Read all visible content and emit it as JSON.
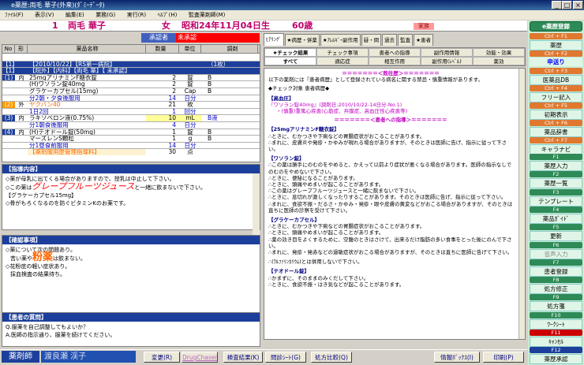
{
  "window": {
    "title": "e薬歴:両毛  華子(外来)(ﾀﾞﾐｰﾃﾞｰﾀ)",
    "controls": [
      "_",
      "□",
      "×"
    ]
  },
  "menu": [
    "ﾌｧｲﾙ(F)",
    "表示(V)",
    "編集(E)",
    "業務(G)",
    "実行(R)",
    "ﾍﾙﾌﾟ(H)",
    "監査薬剤師(M)"
  ],
  "patient": {
    "id": "1",
    "name": "両毛  華子",
    "sex": "女",
    "birth": "昭和24年11月04日生",
    "age": "60歳",
    "family": "家族"
  },
  "approver": {
    "label": "承認者",
    "value": "未承認"
  },
  "rx": {
    "headers": [
      "No",
      "形",
      "薬品名称",
      "数量",
      "単位",
      "調剤"
    ],
    "rows": [
      {
        "no": "",
        "form": "",
        "name": "",
        "qty": "",
        "unit": "",
        "note": ""
      },
      {
        "no": "【1】",
        "form": "",
        "name": "【2010/10/22】【RS第一病院】",
        "qty": "",
        "unit": "",
        "note": "（1枚）"
      },
      {
        "no": "【1】",
        "form": "",
        "name": "【院外】【内科】【両毛  華】【 未承認】",
        "qty": "",
        "unit": "",
        "note": ""
      },
      {
        "no": "(1)",
        "form": "内",
        "name": "25mgアリナミンF糖衣錠",
        "qty": "2",
        "unit": "錠",
        "note": "B"
      },
      {
        "no": "",
        "form": "",
        "name": "(H)ワソラン錠40mg",
        "qty": "2",
        "unit": "錠",
        "note": "B"
      },
      {
        "no": "",
        "form": "",
        "name": "グラケーカプセル(15mg)",
        "qty": "2",
        "unit": "Cap",
        "note": "B"
      },
      {
        "no": "",
        "form": "",
        "name": "分2朝・夕食後服用",
        "qty": "14",
        "unit": "日分",
        "note": ""
      },
      {
        "no": "(2)",
        "form": "外",
        "name": "ヤクバン40",
        "qty": "21",
        "unit": "枚",
        "note": ""
      },
      {
        "no": "",
        "form": "",
        "name": "1日2回",
        "qty": "1",
        "unit": "回分",
        "note": ""
      },
      {
        "no": "(3)",
        "form": "内",
        "name": "ラキソベロン液(0.75%)",
        "qty": "10",
        "unit": "mL",
        "note": "B液"
      },
      {
        "no": "",
        "form": "",
        "name": "分1朝食後服用",
        "qty": "4",
        "unit": "日分",
        "note": ""
      },
      {
        "no": "(4)",
        "form": "内",
        "name": "(H)テオドール錠(50mg)",
        "qty": "1",
        "unit": "錠",
        "note": "B"
      },
      {
        "no": "",
        "form": "",
        "name": "マーズレンS顆粒",
        "qty": "1",
        "unit": "g",
        "note": "B"
      },
      {
        "no": "",
        "form": "",
        "name": "分1昼食前服用",
        "qty": "14",
        "unit": "日分",
        "note": ""
      },
      {
        "no": "",
        "form": "",
        "name": "【薬剤服用歴管理指導料】",
        "qty": "30",
        "unit": "点",
        "note": ""
      }
    ]
  },
  "guidance": {
    "title": "【指導内容】",
    "lines": [
      "◇薬が母乳に出てくる場合がありますので、授乳は中止して下さい。",
      "◇この薬は",
      "グレープフルーツジュース",
      "と一緒に飲まないで下さい。",
      "【グラケーカプセル15mg】",
      "◇骨がもろくなるのを防ぐビタミンKのお薬です。"
    ]
  },
  "confirm": {
    "title": "【確認事項】",
    "lines": [
      "◇薬について次の問題あり。",
      "苦い薬や",
      "粉薬",
      "は飲まない。",
      "◇花粉症の軽い症状あり。",
      "採血検査の結果待ち。"
    ]
  },
  "question": {
    "title": "【患者の質問】",
    "lines": [
      "Q.服薬を自己調整してもよいか？",
      "A.医師の指示通り、服薬を続けてください。"
    ]
  },
  "tabs_top": [
    "ﾋｱﾘﾝｸﾞ",
    "★病歴・併薬",
    "★ｱﾚﾙｷﾞｰ副作用",
    "疑・問",
    "過去",
    "監査",
    "★患者"
  ],
  "tabs_mid": [
    "★チェック結果",
    "チェック事項",
    "患者への指導",
    "副作用情報",
    "効能・効果"
  ],
  "tabs_low": [
    "すべて",
    "適応症",
    "相互作用",
    "副作用(ﾚﾍﾞﾙ)",
    "薬効"
  ],
  "info": {
    "title": "＝＝＝＝＝＝＝＜既往歴＞＝＝＝＝＝＝＝",
    "intro": "以下の薬剤には『患者病歴』として登録されている病名に関する禁忌・慎重情報があります。",
    "check_note": "◆チェック対象  患者病歴◆",
    "disease": "【高血圧】",
    "drug1": "『ワソラン錠40mg』(調剤日:2010/10/22-14日分-No.1)",
    "warn1": "・(慎重)重篤心疾患(心筋症、弁膜症、高血圧性心疾患等)",
    "guide_title": "＝＝＝＝＝＝＝＜患者への指導＞＝＝＝＝＝＝＝",
    "sections": [
      {
        "name": "【25mgアリナミンF糖衣錠】",
        "text": [
          "∴ときに、むかつきや下痢などの胃腸症状がおこることがあります。",
          "∴まれに、皮膚炎や発疹・かゆみが現れる場合がありますが、そのときは医師に告げ、指示に従って下さい。"
        ]
      },
      {
        "name": "【ワソラン錠】",
        "text": [
          "∴この薬は勝手にのむのをやめると、かえって以前より症状が悪くなる場合があります。医師の指示なしでのむのをやめないで下さい。",
          "∴ときに、便秘になることがあります。",
          "∴ときに、頭痛やめまいが起こることがあります。",
          "∴この薬はグレープフルーツジュースと一緒に飲まないで下さい。",
          "∴ときに、息切れが激しくなったりすることがあります。そのときは医師に告げ、指示に従って下さい。",
          "∴まれに、食欲不振・だるさ・かゆみ・発疹・眼や皮膚の黄変などがおこる場合がありますが、そのときは直ちに医師の診察を受けて下さい。"
        ]
      },
      {
        "name": "【グラケーカプセル】",
        "text": [
          "∴ときに、むかつきや下痢などの胃腸症状がおこることがあります。",
          "∴ときに、頭痛やめまいが起こることがあります。",
          "∴薬の効き目をよくするために、空腹のときはさけて、出来るだけ脂肪の多い食事をとった後にのんで下さい。",
          "∴まれに、発疹・発赤などの過敏症状がおこる場合がありますが、そのときは直ちに医師に告げて下さい。"
        ]
      },
      {
        "name": "∴(ﾜﾙﾌｧﾘﾝｶﾘｳﾑ)とは併用しないで下さい。",
        "text": []
      },
      {
        "name": "【テオドール錠】",
        "text": [
          "∴かまずに、そのままのみくだして下さい。",
          "∴ときに、食欲不振・はき気などが起こることがあります。"
        ]
      }
    ]
  },
  "side": {
    "title": "e薬歴登録",
    "items": [
      {
        "k": "Ctrl + F1",
        "l": "薬歴"
      },
      {
        "k": "Ctrl + F2",
        "l": "申送り"
      },
      {
        "k": "Ctrl + F3",
        "l": "医薬品DB"
      },
      {
        "k": "Ctrl + F4",
        "l": "フリー記入"
      },
      {
        "k": "Ctrl + F5",
        "l": "初期表示"
      },
      {
        "k": "Ctrl + F6",
        "l": "薬品辞書"
      },
      {
        "k": "Ctrl + F7",
        "l": "キャラナビ"
      }
    ],
    "fkeys": [
      {
        "k": "F1",
        "l": "薬歴入力"
      },
      {
        "k": "F2",
        "l": "薬歴一覧"
      },
      {
        "k": "F3",
        "l": "テンプレート"
      },
      {
        "k": "F4",
        "l": "薬品ｶﾞｲﾄﾞ"
      },
      {
        "k": "F5",
        "l": "更新"
      },
      {
        "k": "F6",
        "l": "音声入力"
      },
      {
        "k": "F7",
        "l": "患者登録"
      },
      {
        "k": "F8",
        "l": "処方修正"
      },
      {
        "k": "F9",
        "l": "処方箋"
      },
      {
        "k": "F10",
        "l": "ﾜｰｸｼｰﾄ"
      },
      {
        "k": "F11",
        "l": "ｷｬﾝｾﾙ"
      },
      {
        "k": "F12",
        "l": "薬歴承認"
      }
    ]
  },
  "bottom": {
    "role": "薬剤師",
    "pharmacist": "渡良瀬  渓子",
    "buttons": [
      "変更(R)",
      "DrugChaser",
      "検査結果(K)",
      "問診ｼｰﾄ(G)",
      "処方比較(Q)",
      "情報ﾎﾞｯｸｽ(I)",
      "印刷(P)"
    ]
  }
}
